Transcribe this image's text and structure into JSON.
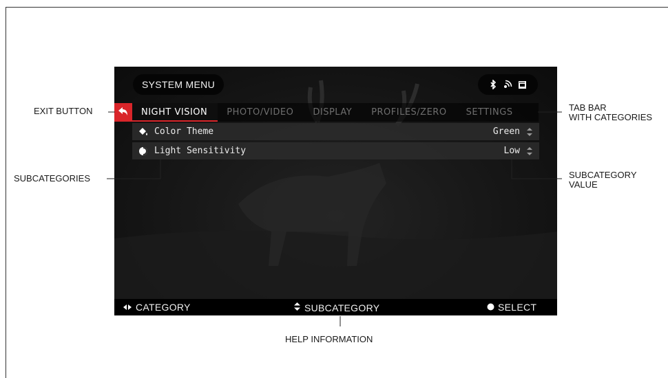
{
  "header": {
    "system_menu": "SYSTEM MENU"
  },
  "status_icons": [
    "bluetooth-icon",
    "wifi-icon",
    "sd-card-icon"
  ],
  "tabs": [
    {
      "label": "NIGHT VISION",
      "active": true
    },
    {
      "label": "PHOTO/VIDEO",
      "active": false
    },
    {
      "label": "DISPLAY",
      "active": false
    },
    {
      "label": "PROFILES/ZERO",
      "active": false
    },
    {
      "label": "SETTINGS",
      "active": false
    }
  ],
  "rows": [
    {
      "label": "Color Theme",
      "value": "Green",
      "icon": "paint-bucket-icon"
    },
    {
      "label": "Light Sensitivity",
      "value": "Low",
      "icon": "contrast-icon"
    }
  ],
  "help": {
    "category": "CATEGORY",
    "subcategory": "SUBCATEGORY",
    "select": "SELECT"
  },
  "callouts": {
    "exit_button": "EXIT BUTTON",
    "tab_bar_line1": "TAB BAR",
    "tab_bar_line2": "WITH CATEGORIES",
    "subcategories": "SUBCATEGORIES",
    "subcategory_value_line1": "SUBCATEGORY",
    "subcategory_value_line2": "VALUE",
    "help_information": "HELP INFORMATION"
  },
  "colors": {
    "accent": "#d9252a",
    "screen_bg": "#151515"
  }
}
